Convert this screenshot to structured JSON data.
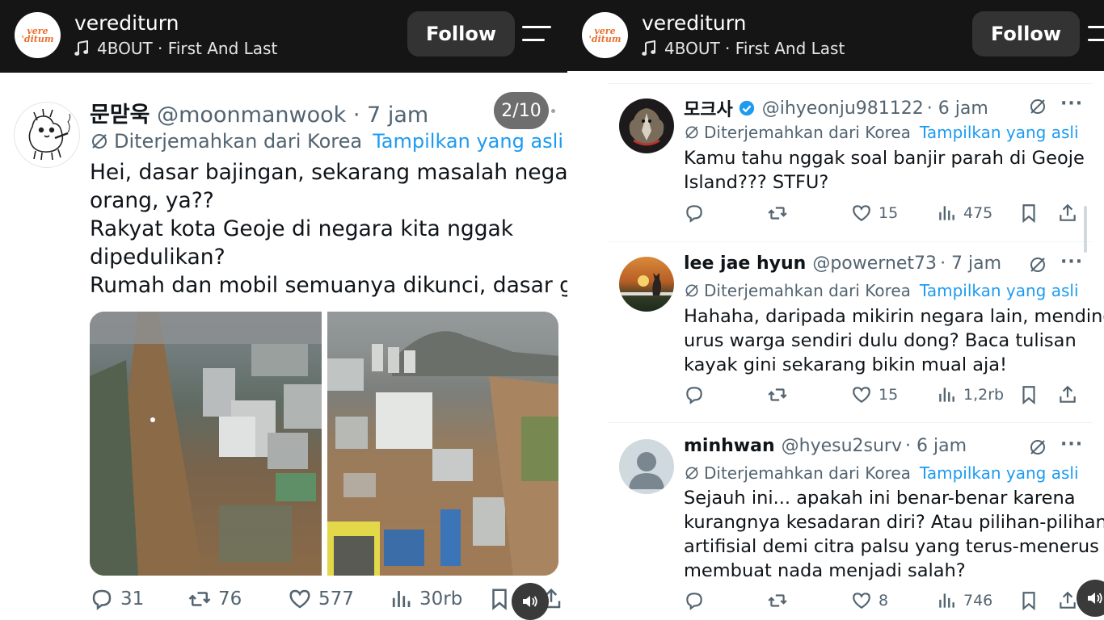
{
  "header": {
    "username": "verediturn",
    "music": "4BOUT · First And Last",
    "follow_label": "Follow",
    "logo_top": "vere",
    "logo_bottom": "'ditum"
  },
  "header_right": {
    "username": "verediturn",
    "music": "4BOUT · First And Last",
    "follow_label": "Follow"
  },
  "tweet": {
    "name": "문맏욱",
    "handle": "@moonmanwook",
    "time": "· 7 jam",
    "page_indicator": "2/10",
    "translated_from": "Diterjemahkan dari Korea",
    "show_original": "Tampilkan yang asli",
    "body": [
      "Hei, dasar bajingan, sekarang masalah negara",
      "orang, ya??",
      "Rakyat kota Geoje di negara kita nggak",
      "dipedulikan?",
      "Rumah dan mobil semuanya dikunci, dasar gila"
    ],
    "stats": {
      "replies": "31",
      "reposts": "76",
      "likes": "577",
      "views": "30rb"
    },
    "icons": [
      "reply-icon",
      "repost-icon",
      "like-icon",
      "views-icon",
      "bookmark-icon",
      "share-icon",
      "sound-icon"
    ]
  },
  "replies": [
    {
      "name": "모크사",
      "handle": "@ihyeonju981122",
      "time": "· 6 jam",
      "verified": true,
      "translated_from": "Diterjemahkan dari Korea",
      "show_original": "Tampilkan yang asli",
      "body": [
        "Kamu tahu nggak soal banjir parah di Geoje",
        "Island??? STFU?"
      ],
      "stats": {
        "replies": "",
        "reposts": "",
        "likes": "15",
        "views": "475"
      }
    },
    {
      "name": "lee jae hyun",
      "handle": "@powernet73",
      "time": "· 7 jam",
      "verified": false,
      "translated_from": "Diterjemahkan dari Korea",
      "show_original": "Tampilkan yang asli",
      "body": [
        "Hahaha, daripada mikirin negara lain, mending",
        "urus warga sendiri dulu dong? Baca tulisan",
        "kayak gini sekarang bikin mual aja!"
      ],
      "stats": {
        "replies": "",
        "reposts": "",
        "likes": "15",
        "views": "1,2rb"
      }
    },
    {
      "name": "minhwan",
      "handle": "@hyesu2surv",
      "time": "· 6 jam",
      "verified": false,
      "translated_from": "Diterjemahkan dari Korea",
      "show_original": "Tampilkan yang asli",
      "body": [
        "Sejauh ini... apakah ini benar-benar karena",
        "kurangnya kesadaran diri? Atau pilihan-pilihan",
        "artifisial demi citra palsu yang terus-menerus",
        "membuat nada menjadi salah?"
      ],
      "stats": {
        "replies": "",
        "reposts": "",
        "likes": "8",
        "views": "746"
      }
    }
  ],
  "colors": {
    "accent": "#1d9bf0",
    "muted": "#536471",
    "header_bg": "#151515",
    "logo": "#e8712e"
  }
}
